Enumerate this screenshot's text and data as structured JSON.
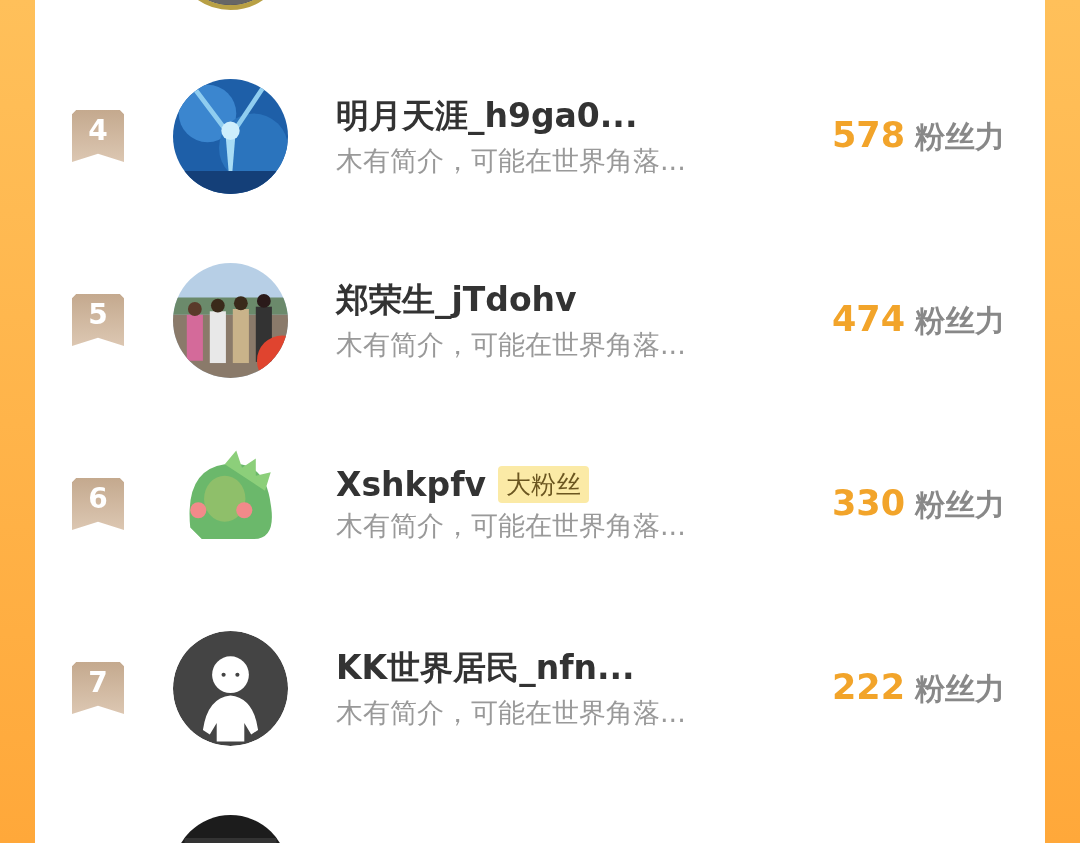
{
  "ranking": [
    {
      "avatar": {
        "kind": "picture",
        "ring": true
      }
    },
    {
      "rank": "4",
      "avatar": {
        "kind": "picture",
        "ring": false
      },
      "name": "明月天涯_h9ga0...",
      "bio": "木有简介，可能在世界角落...",
      "score": "578",
      "score_unit": "粉丝力"
    },
    {
      "rank": "5",
      "avatar": {
        "kind": "picture",
        "ring": false
      },
      "name": "郑荣生_jTdohv",
      "bio": "木有简介，可能在世界角落...",
      "score": "474",
      "score_unit": "粉丝力"
    },
    {
      "rank": "6",
      "avatar": {
        "kind": "picture",
        "ring": false
      },
      "name": "Xshkpfv",
      "badge": "大粉丝",
      "bio": "木有简介，可能在世界角落...",
      "score": "330",
      "score_unit": "粉丝力"
    },
    {
      "rank": "7",
      "avatar": {
        "kind": "default",
        "ring": false
      },
      "name": "KK世界居民_nfn...",
      "bio": "木有简介，可能在世界角落...",
      "score": "222",
      "score_unit": "粉丝力"
    },
    {
      "avatar": {
        "kind": "picture",
        "ring": false
      }
    }
  ]
}
